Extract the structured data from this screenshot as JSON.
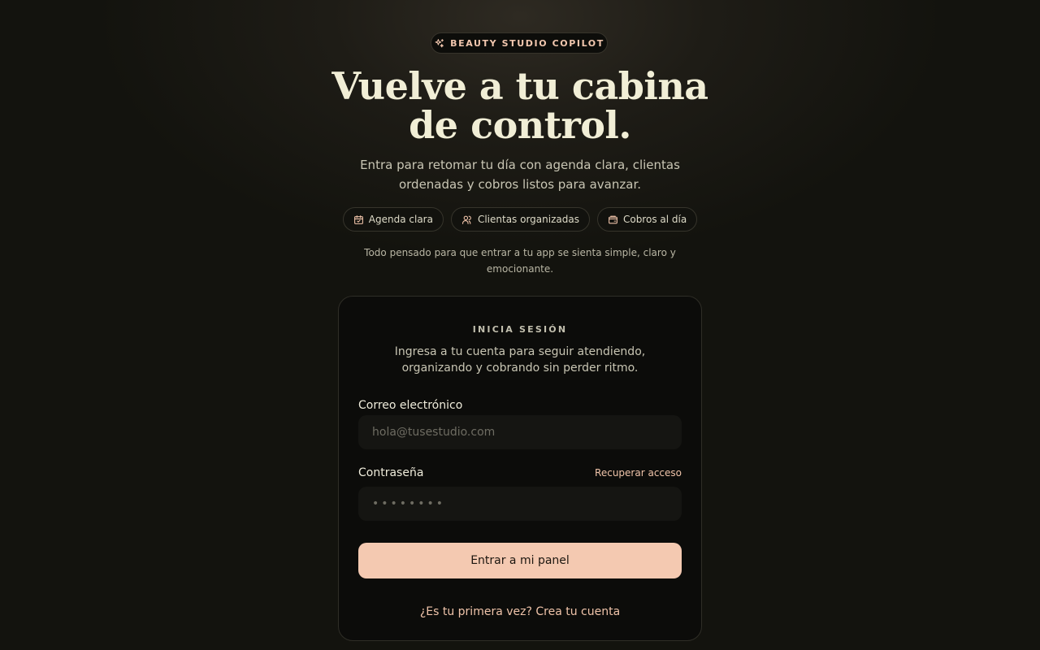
{
  "badge": {
    "icon": "sparkles-icon",
    "text": "BEAUTY STUDIO COPILOT"
  },
  "hero": {
    "title_line1": "Vuelve a tu cabina",
    "title_line2": "de control.",
    "subtitle": "Entra para retomar tu día con agenda clara, clientas ordenadas y cobros listos para avanzar."
  },
  "chips": [
    {
      "icon": "calendar-icon",
      "label": "Agenda clara"
    },
    {
      "icon": "users-icon",
      "label": "Clientas organizadas"
    },
    {
      "icon": "wallet-icon",
      "label": "Cobros al día"
    }
  ],
  "note": "Todo pensado para que entrar a tu app se sienta simple, claro y emocionante.",
  "login": {
    "eyebrow": "INICIA SESIÓN",
    "description": "Ingresa a tu cuenta para seguir atendiendo, organizando y cobrando sin perder ritmo.",
    "email_label": "Correo electrónico",
    "email_placeholder": "hola@tusestudio.com",
    "email_value": "",
    "password_label": "Contraseña",
    "password_placeholder": "••••••••",
    "password_value": "",
    "recover_link": "Recuperar acceso",
    "submit_label": "Entrar a mi panel",
    "signup_link": "¿Es tu primera vez? Crea tu cuenta"
  },
  "colors": {
    "accent": "#f4c9b1",
    "accent_text": "#f0c4aa",
    "background": "#13130e",
    "card": "#0c0c0a",
    "heading": "#f1eed6"
  }
}
